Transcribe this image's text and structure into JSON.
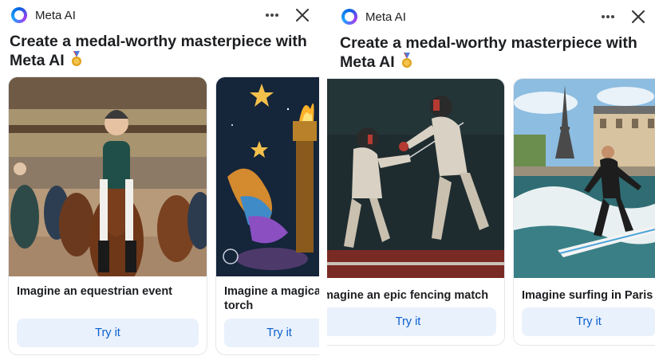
{
  "panels": [
    {
      "header": {
        "brand": "Meta AI",
        "more_icon": "more-icon",
        "close_icon": "close-icon"
      },
      "headline": "Create a medal-worthy masterpiece with Meta AI",
      "cards": [
        {
          "caption": "Imagine an equestrian event",
          "button": "Try it",
          "image": "equestrian-rider-photo"
        },
        {
          "caption": "Imagine a magical torch",
          "button": "Try it",
          "image": "magical-torch-illustration"
        }
      ]
    },
    {
      "header": {
        "brand": "Meta AI",
        "more_icon": "more-icon",
        "close_icon": "close-icon"
      },
      "headline": "Create a medal-worthy masterpiece with Meta AI",
      "cards": [
        {
          "caption": "Imagine an epic fencing match",
          "button": "Try it",
          "image": "fencing-match-photo"
        },
        {
          "caption": "Imagine surfing in Paris",
          "button": "Try it",
          "image": "surfing-paris-photo"
        }
      ]
    }
  ],
  "colors": {
    "accent": "#0a5ecf",
    "button_bg": "#e9f1fc",
    "text": "#1c1e21",
    "medal": "#e0a21a"
  }
}
